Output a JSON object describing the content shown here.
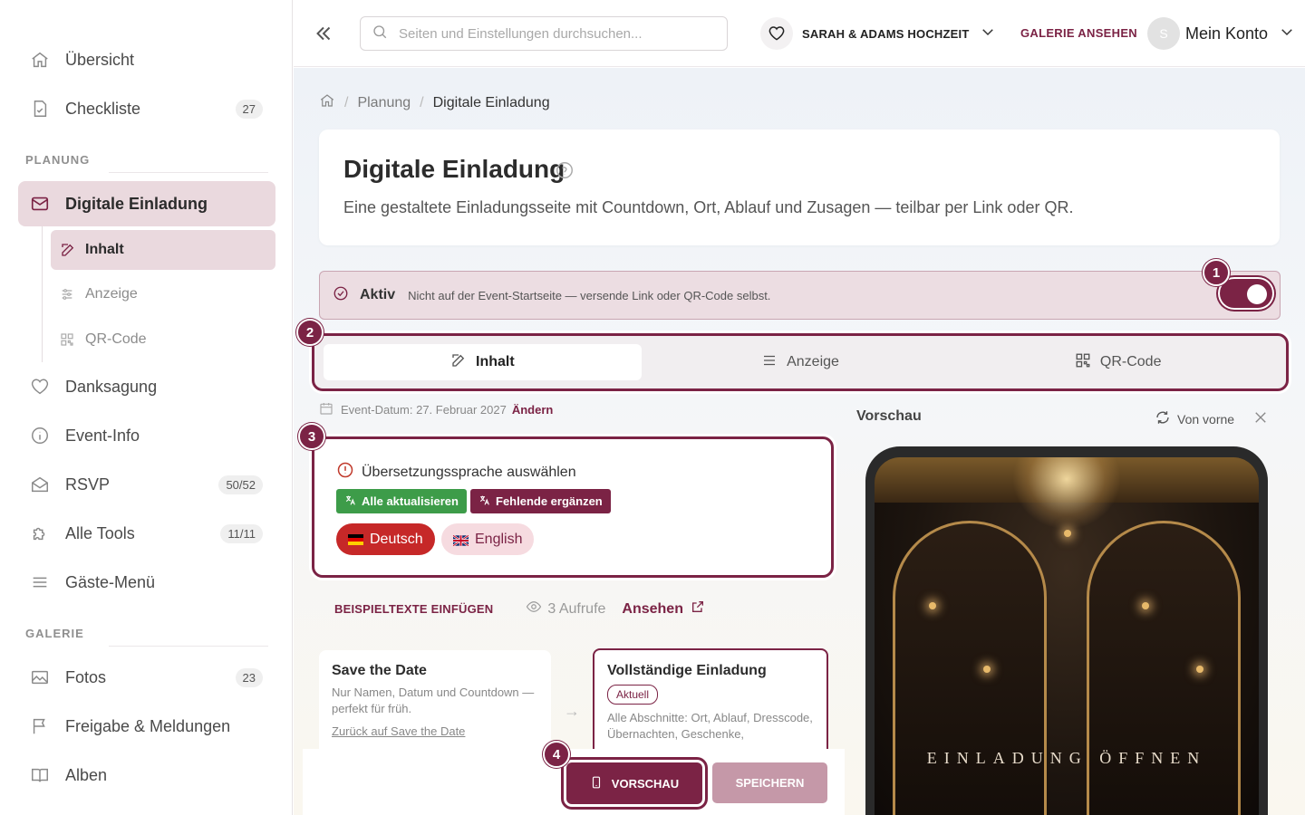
{
  "sidebar": {
    "items_top": [
      {
        "label": "Übersicht",
        "badge": ""
      },
      {
        "label": "Checkliste",
        "badge": "27"
      }
    ],
    "section_planung": "PLANUNG",
    "active_item": "Digitale Einladung",
    "sub_items": [
      "Inhalt",
      "Anzeige",
      "QR-Code"
    ],
    "items_mid": [
      {
        "label": "Danksagung",
        "badge": ""
      },
      {
        "label": "Event-Info",
        "badge": ""
      },
      {
        "label": "RSVP",
        "badge": "50/52"
      },
      {
        "label": "Alle Tools",
        "badge": "11/11"
      },
      {
        "label": "Gäste-Menü",
        "badge": ""
      }
    ],
    "section_galerie": "GALERIE",
    "items_gallery": [
      {
        "label": "Fotos",
        "badge": "23"
      },
      {
        "label": "Freigabe & Meldungen",
        "badge": ""
      },
      {
        "label": "Alben",
        "badge": ""
      }
    ]
  },
  "topbar": {
    "search_placeholder": "Seiten und Einstellungen durchsuchen...",
    "event_name": "SARAH & ADAMS HOCHZEIT",
    "gallery_link": "GALERIE ANSEHEN",
    "avatar_initial": "S",
    "account_label": "Mein Konto"
  },
  "breadcrumb": {
    "parent": "Planung",
    "current": "Digitale Einladung"
  },
  "header": {
    "title": "Digitale Einladung",
    "description": "Eine gestaltete Einladungsseite mit Countdown, Ort, Ablauf und Zusagen — teilbar per Link oder QR."
  },
  "status": {
    "label": "Aktiv",
    "text": "Nicht auf der Event-Startseite — versende Link oder QR-Code selbst.",
    "enabled": true
  },
  "steps": [
    "1",
    "2",
    "3",
    "4"
  ],
  "tabs": [
    {
      "label": "Inhalt",
      "active": true
    },
    {
      "label": "Anzeige",
      "active": false
    },
    {
      "label": "QR-Code",
      "active": false
    }
  ],
  "event_date": {
    "text": "Event-Datum: 27. Februar 2027",
    "change": "Ändern"
  },
  "language": {
    "heading": "Übersetzungssprache auswählen",
    "update_all": "Alle aktualisieren",
    "fill_missing": "Fehlende ergänzen",
    "languages": [
      {
        "label": "Deutsch",
        "selected": true
      },
      {
        "label": "English",
        "selected": false
      }
    ]
  },
  "actions": {
    "sample_texts": "BEISPIELTEXTE EINFÜGEN",
    "views": "3 Aufrufe",
    "view_link": "Ansehen"
  },
  "cards": {
    "save_the_date": {
      "title": "Save the Date",
      "text": "Nur Namen, Datum und Countdown — perfekt für früh.",
      "link": "Zurück auf Save the Date"
    },
    "full": {
      "title": "Vollständige Einladung",
      "badge": "Aktuell",
      "text": "Alle Abschnitte: Ort, Ablauf, Dresscode, Übernachten, Geschenke,"
    }
  },
  "buttons": {
    "preview": "VORSCHAU",
    "save": "SPEICHERN"
  },
  "preview": {
    "heading": "Vorschau",
    "reset": "Von vorne",
    "invite_text": "EINLADUNG ÖFFNEN"
  },
  "colors": {
    "accent": "#7b2345",
    "accent_light": "#ead9de",
    "green": "#3d9c49",
    "red": "#c62828"
  }
}
